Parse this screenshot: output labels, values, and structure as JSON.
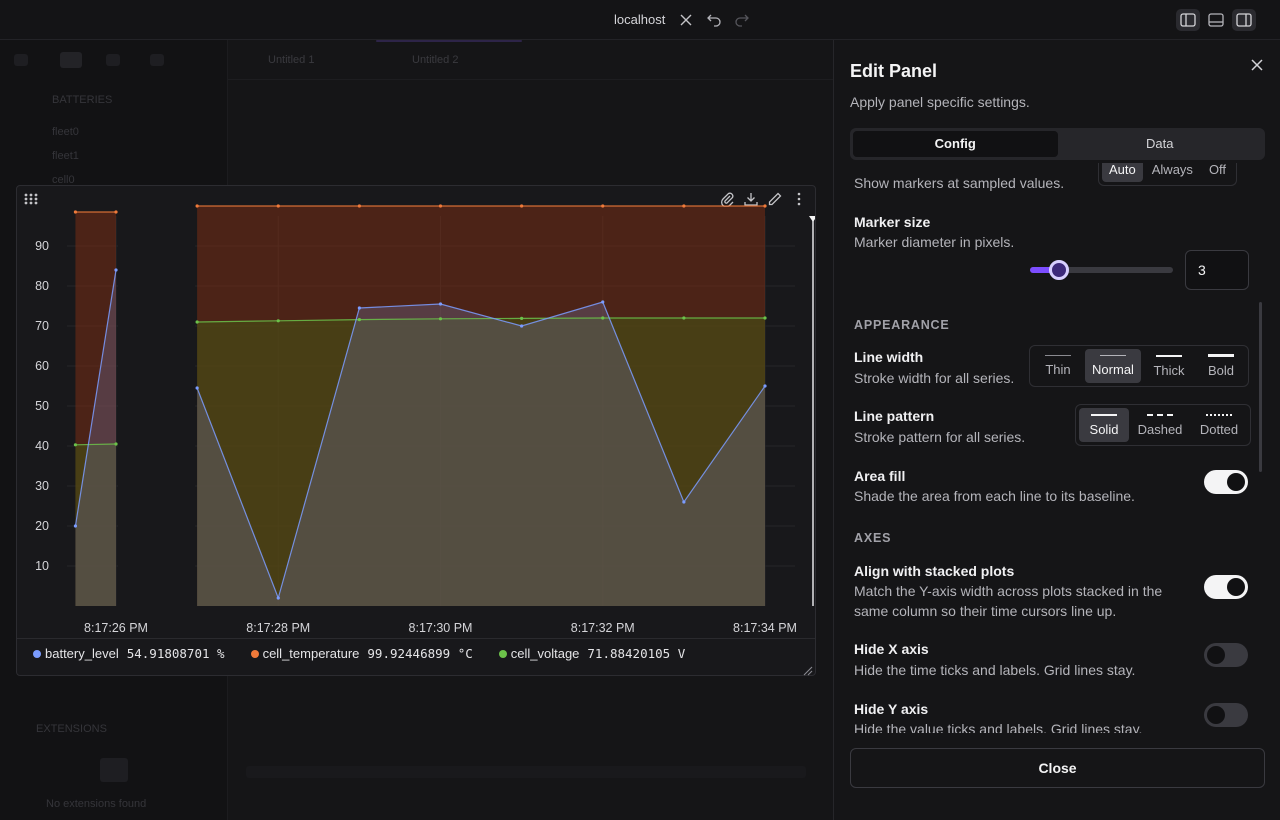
{
  "titlebar": {
    "host": "localhost"
  },
  "background": {
    "tabs": [
      "Untitled 1",
      "Untitled 2"
    ],
    "tree_root": "BATTERIES",
    "tree_items": [
      "fleet0",
      "fleet1",
      "cell0"
    ],
    "extensions_header": "EXTENSIONS",
    "no_extensions": "No extensions found"
  },
  "chart_data": {
    "type": "area",
    "x": [
      "8:17:25.5",
      "8:17:26",
      "8:17:26.5",
      "8:17:27",
      "8:17:28",
      "8:17:29",
      "8:17:30",
      "8:17:31",
      "8:17:32",
      "8:17:33",
      "8:17:34"
    ],
    "xticks": [
      "8:17:26 PM",
      "8:17:28 PM",
      "8:17:30 PM",
      "8:17:32 PM",
      "8:17:34 PM"
    ],
    "yticks": [
      "10",
      "20",
      "30",
      "40",
      "50",
      "60",
      "70",
      "80",
      "90"
    ],
    "ylim": [
      0,
      100
    ],
    "series": [
      {
        "name": "battery_level",
        "unit": "%",
        "color": "#7b9cff",
        "values": [
          20,
          84,
          null,
          54.5,
          2,
          74.5,
          75.5,
          70,
          76,
          26,
          55
        ]
      },
      {
        "name": "cell_temperature",
        "unit": "°C",
        "color": "#f07a3a",
        "values": [
          98.5,
          98.5,
          null,
          100,
          100,
          100,
          100,
          100,
          100,
          100,
          100
        ]
      },
      {
        "name": "cell_voltage",
        "unit": "V",
        "color": "#6cc24a",
        "values": [
          40.3,
          40.5,
          null,
          71,
          71.3,
          71.6,
          71.8,
          71.9,
          72,
          72,
          72
        ]
      }
    ],
    "legend": [
      {
        "name": "battery_level",
        "value": "54.91808701 %"
      },
      {
        "name": "cell_temperature",
        "value": "99.92446899 °C"
      },
      {
        "name": "cell_voltage",
        "value": "71.88420105 V"
      }
    ],
    "area_fill": true
  },
  "edit_panel": {
    "title": "Edit Panel",
    "subtitle": "Apply panel specific settings.",
    "tabs": [
      "Config",
      "Data"
    ],
    "markers": {
      "desc": "Show markers at sampled values.",
      "options": [
        "Auto",
        "Always",
        "Off"
      ],
      "selected": "Auto"
    },
    "marker_size": {
      "title": "Marker size",
      "desc": "Marker diameter in pixels.",
      "value": "3",
      "level": 0.2
    },
    "appearance_header": "APPEARANCE",
    "line_width": {
      "title": "Line width",
      "desc": "Stroke width for all series.",
      "options": [
        "Thin",
        "Normal",
        "Thick",
        "Bold"
      ],
      "selected": "Normal"
    },
    "line_pattern": {
      "title": "Line pattern",
      "desc": "Stroke pattern for all series.",
      "options": [
        "Solid",
        "Dashed",
        "Dotted"
      ],
      "selected": "Solid"
    },
    "area_fill": {
      "title": "Area fill",
      "desc": "Shade the area from each line to its baseline.",
      "on": true
    },
    "axes_header": "AXES",
    "align_stacked": {
      "title": "Align with stacked plots",
      "desc1": "Match the Y-axis width across plots stacked in the",
      "desc2": "same column so their time cursors line up.",
      "on": true
    },
    "hide_x": {
      "title": "Hide X axis",
      "desc": "Hide the time ticks and labels. Grid lines stay.",
      "on": false
    },
    "hide_y": {
      "title": "Hide Y axis",
      "desc": "Hide the value ticks and labels. Grid lines stay.",
      "on": false
    },
    "close_label": "Close"
  }
}
